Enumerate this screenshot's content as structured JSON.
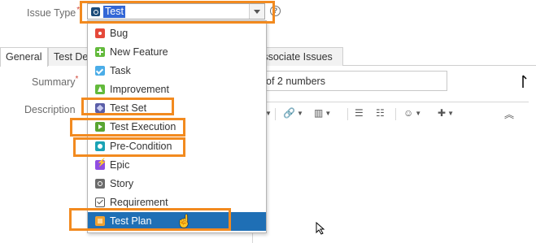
{
  "issue_type": {
    "label": "Issue Type",
    "required_mark": "*",
    "selected_value": "Test",
    "help": "?"
  },
  "tabs": [
    {
      "label": "General"
    },
    {
      "label": "Test De"
    },
    {
      "label": "Associate Issues"
    }
  ],
  "summary": {
    "label": "Summary",
    "required_mark": "*",
    "value": "of 2 numbers"
  },
  "description": {
    "label": "Description"
  },
  "dropdown": {
    "options": [
      {
        "label": "Bug",
        "icon": "bug-icon"
      },
      {
        "label": "New Feature",
        "icon": "new-feature-icon"
      },
      {
        "label": "Task",
        "icon": "task-icon"
      },
      {
        "label": "Improvement",
        "icon": "improvement-icon"
      },
      {
        "label": "Test Set",
        "icon": "test-set-icon"
      },
      {
        "label": "Test Execution",
        "icon": "test-execution-icon"
      },
      {
        "label": "Pre-Condition",
        "icon": "pre-condition-icon"
      },
      {
        "label": "Epic",
        "icon": "epic-icon"
      },
      {
        "label": "Story",
        "icon": "story-icon"
      },
      {
        "label": "Requirement",
        "icon": "requirement-icon"
      },
      {
        "label": "Test Plan",
        "icon": "test-plan-icon",
        "selected": true
      }
    ]
  },
  "colors": {
    "highlight": "#f28a1f",
    "selected_option_bg": "#1f6fb5",
    "selection_text_bg": "#3367d6"
  }
}
